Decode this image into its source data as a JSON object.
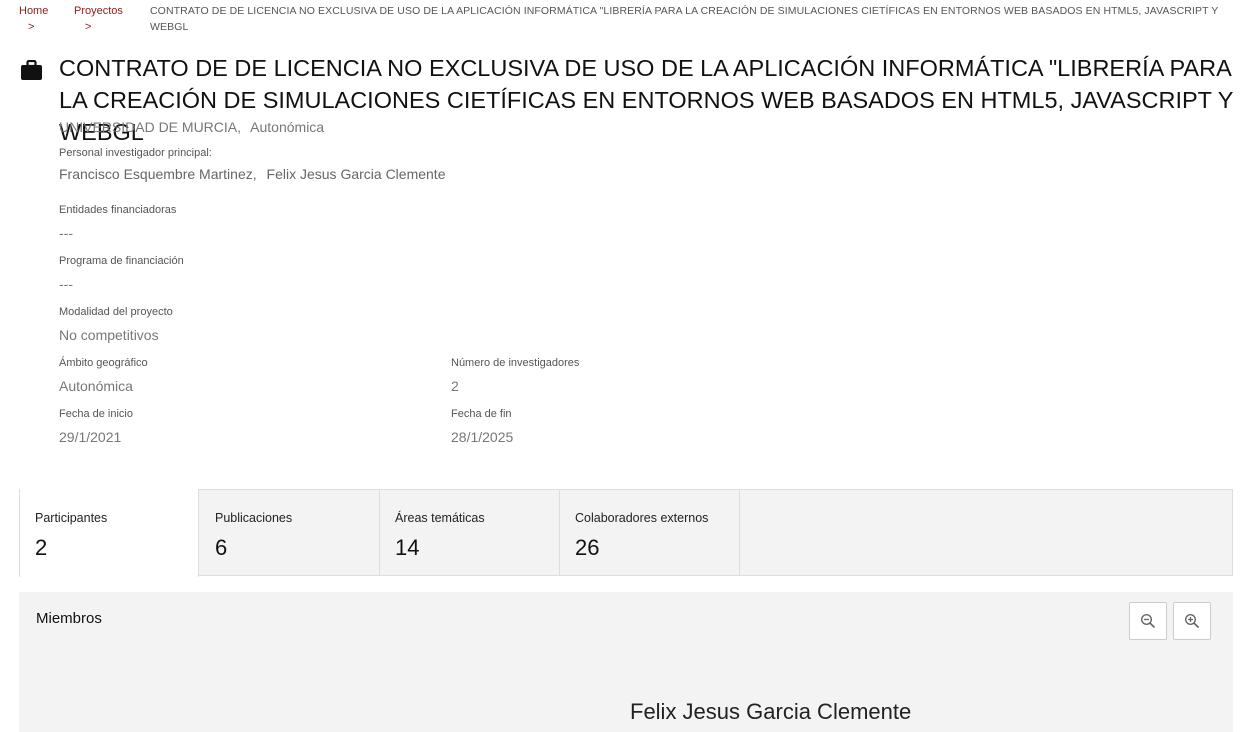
{
  "breadcrumb": {
    "home": "Home",
    "projects": "Proyectos",
    "separator": ">",
    "current": "CONTRATO DE DE LICENCIA NO EXCLUSIVA DE USO DE LA APLICACIÓN INFORMÁTICA \"LIBRERÍA PARA LA CREACIÓN DE SIMULACIONES CIETÍFICAS EN ENTORNOS WEB BASADOS EN HTML5, JAVASCRIPT Y WEBGL"
  },
  "project": {
    "icon": "briefcase-icon",
    "title": "CONTRATO DE DE LICENCIA NO EXCLUSIVA DE USO DE LA APLICACIÓN INFORMÁTICA \"LIBRERÍA PARA LA CREACIÓN DE SIMULACIONES CIETÍFICAS EN ENTORNOS WEB BASADOS EN HTML5, JAVASCRIPT Y WEBGL",
    "orgs": [
      "UNIVERSIDAD DE MURCIA,",
      "Autonómica"
    ]
  },
  "details": {
    "pi_label": "Personal investigador principal:",
    "pi_values": [
      "Francisco Esquembre Martinez,",
      "Felix Jesus Garcia Clemente"
    ],
    "funders_label": "Entidades financiadoras",
    "funders_value": "---",
    "program_label": "Programa de financiación",
    "program_value": "---",
    "modality_label": "Modalidad del proyecto",
    "modality_value": "No competitivos",
    "scope_label": "Ámbito geográfico",
    "scope_value": "Autonómica",
    "researchers_label": "Número de investigadores",
    "researchers_value": "2",
    "start_label": "Fecha de inicio",
    "start_value": "29/1/2021",
    "end_label": "Fecha de fin",
    "end_value": "28/1/2025"
  },
  "tabs": [
    {
      "label": "Participantes",
      "count": "2",
      "active": true
    },
    {
      "label": "Publicaciones",
      "count": "6"
    },
    {
      "label": "Áreas temáticas",
      "count": "14"
    },
    {
      "label": "Colaboradores externos",
      "count": "26"
    }
  ],
  "members_panel": {
    "title": "Miembros",
    "zoom_out_icon": "zoom-out-icon",
    "zoom_in_icon": "zoom-in-icon",
    "node_label": "Felix Jesus Garcia Clemente"
  },
  "colors": {
    "accent": "#8a1c1c",
    "panel_bg": "#f3f3f3"
  }
}
